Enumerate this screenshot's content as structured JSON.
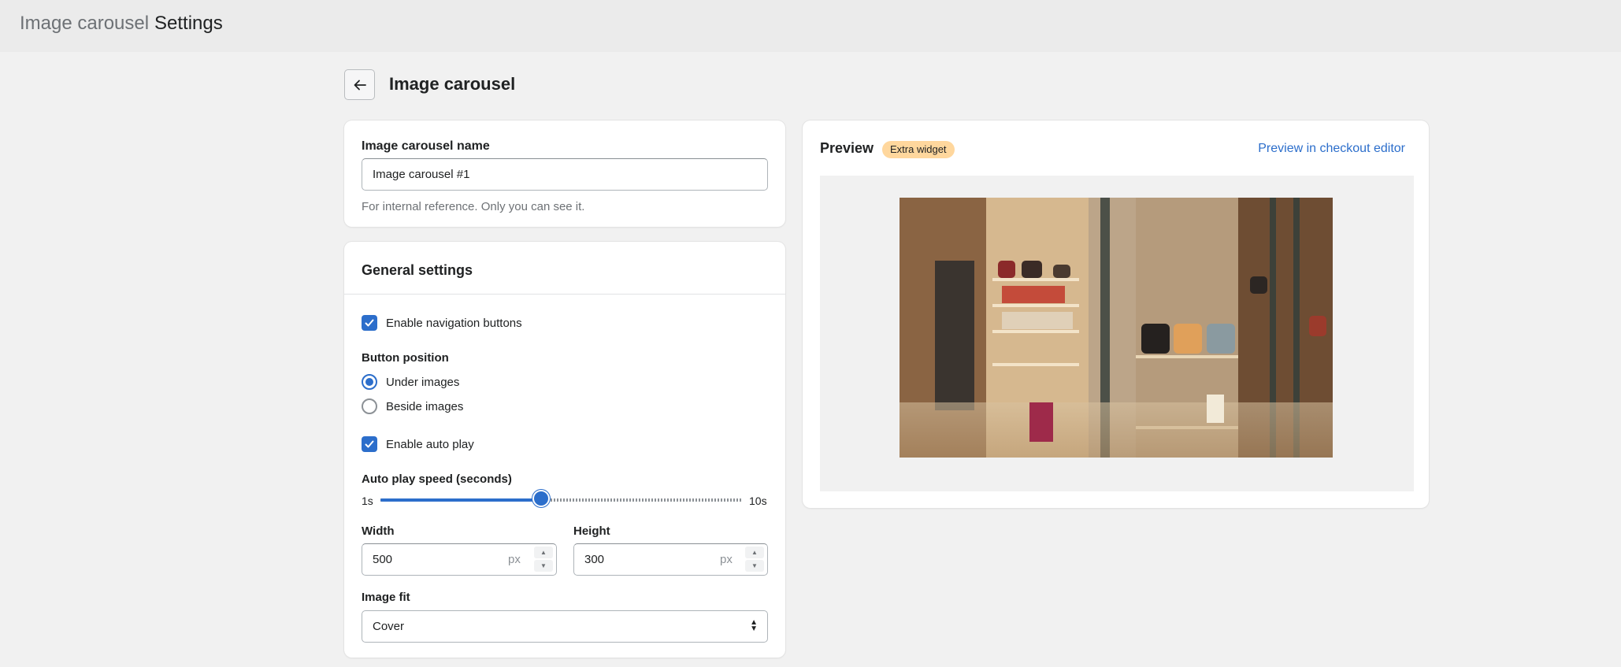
{
  "topbar": {
    "app_name": "Image carousel",
    "page": "Settings"
  },
  "page": {
    "title": "Image carousel"
  },
  "name_card": {
    "label": "Image carousel name",
    "value": "Image carousel #1",
    "help": "For internal reference. Only you can see it."
  },
  "settings": {
    "title": "General settings",
    "nav_buttons": {
      "label": "Enable navigation buttons",
      "checked": true
    },
    "button_position": {
      "label": "Button position",
      "options": [
        {
          "label": "Under images",
          "selected": true
        },
        {
          "label": "Beside images",
          "selected": false
        }
      ]
    },
    "auto_play": {
      "label": "Enable auto play",
      "checked": true
    },
    "speed": {
      "label": "Auto play speed (seconds)",
      "min_label": "1s",
      "max_label": "10s",
      "min": 1,
      "max": 10,
      "value": 5
    },
    "width": {
      "label": "Width",
      "value": "500",
      "unit": "px"
    },
    "height": {
      "label": "Height",
      "value": "300",
      "unit": "px"
    },
    "image_fit": {
      "label": "Image fit",
      "value": "Cover"
    }
  },
  "preview": {
    "title": "Preview",
    "badge": "Extra widget",
    "link": "Preview in checkout editor"
  },
  "colors": {
    "accent": "#2c6ecb",
    "badge": "#ffd79d"
  }
}
